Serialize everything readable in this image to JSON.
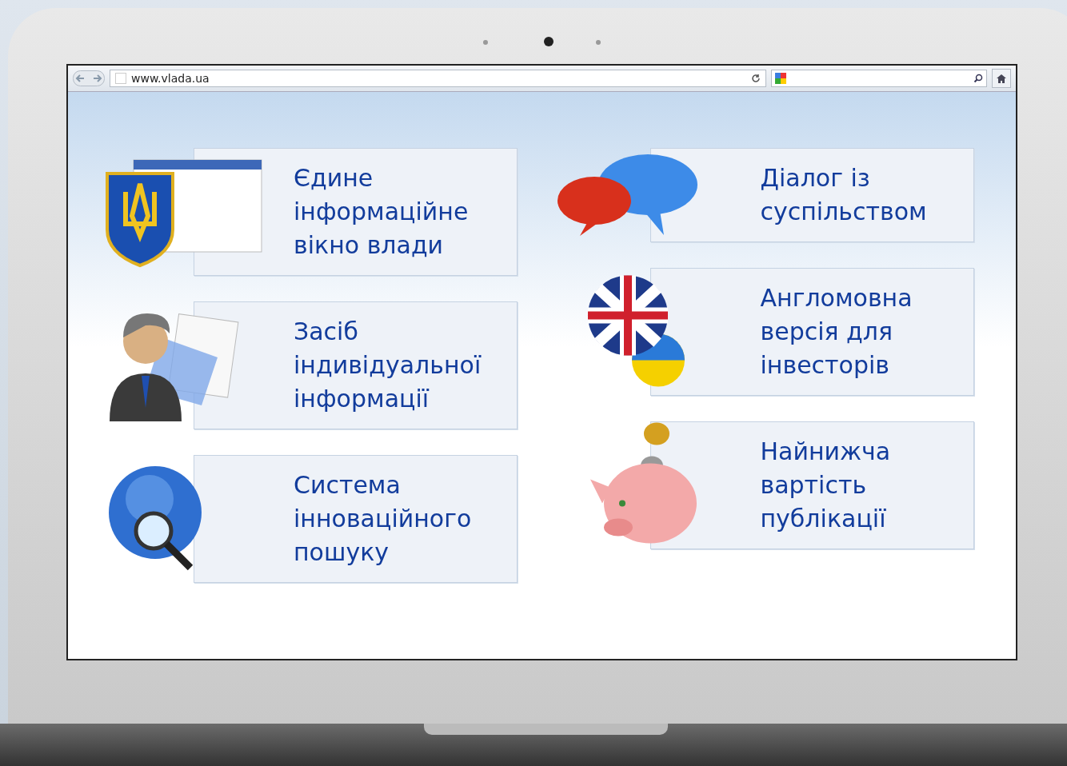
{
  "browser": {
    "url": "www.vlada.ua"
  },
  "columns": [
    {
      "tiles": [
        {
          "kind": "emblem",
          "lines": [
            "Єдине",
            "інформаційне",
            "вікно влади"
          ]
        },
        {
          "kind": "person",
          "lines": [
            "Засіб",
            "індивідуальної",
            "інформації"
          ]
        },
        {
          "kind": "globe",
          "lines": [
            "Система",
            "інноваційного",
            "пошуку"
          ]
        }
      ]
    },
    {
      "tiles": [
        {
          "kind": "chat",
          "lines": [
            "Діалог із",
            "суспільством"
          ]
        },
        {
          "kind": "flags",
          "lines": [
            "Англомовна",
            "версія для",
            "інвесторів"
          ]
        },
        {
          "kind": "piggy",
          "lines": [
            "Найнижча",
            "вартість",
            "публікації"
          ]
        }
      ]
    }
  ]
}
